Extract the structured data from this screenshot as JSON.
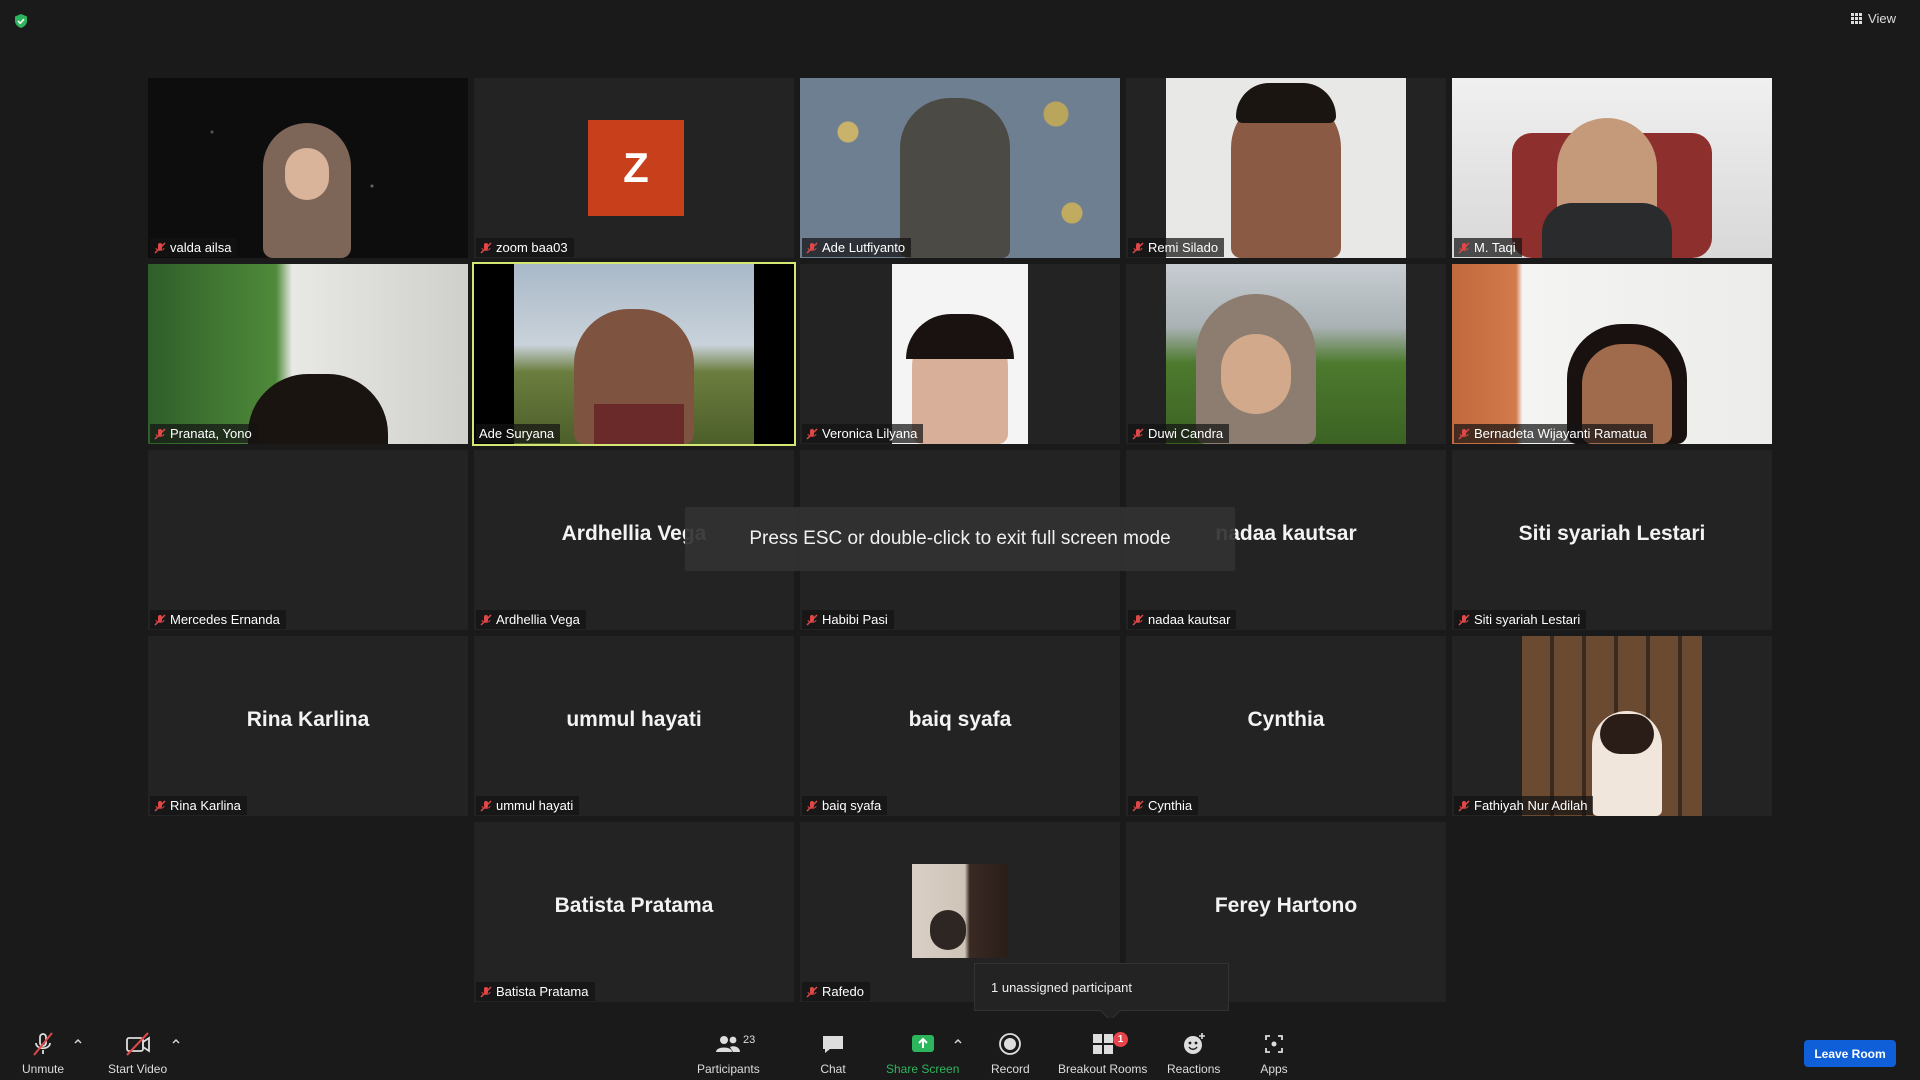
{
  "view_label": "View",
  "toast": "Press ESC or double-click to exit full screen mode",
  "breakout_popup": "1 unassigned participant",
  "participants": [
    {
      "name": "valda ailsa"
    },
    {
      "name": "zoom baa03",
      "initial": "Z"
    },
    {
      "name": "Ade Lutfiyanto"
    },
    {
      "name": "Remi Silado"
    },
    {
      "name": "M. Taqi"
    },
    {
      "name": "Pranata, Yono"
    },
    {
      "name": "Ade Suryana"
    },
    {
      "name": "Veronica Lilyana"
    },
    {
      "name": "Duwi Candra"
    },
    {
      "name": "Bernadeta Wijayanti Ramatua"
    },
    {
      "name": "Mercedes Ernanda"
    },
    {
      "name": "Ardhellia Vega",
      "display": "Ardhellia Vega"
    },
    {
      "name": "Habibi Pasi"
    },
    {
      "name": "nadaa kautsar",
      "display": "nadaa kautsar"
    },
    {
      "name": "Siti syariah Lestari",
      "display": "Siti syariah Lestari"
    },
    {
      "name": "Rina Karlina",
      "display": "Rina Karlina"
    },
    {
      "name": "ummul hayati",
      "display": "ummul hayati"
    },
    {
      "name": "baiq syafa",
      "display": "baiq syafa"
    },
    {
      "name": "Cynthia",
      "display": "Cynthia"
    },
    {
      "name": "Fathiyah Nur Adilah"
    },
    {
      "name": "Batista Pratama",
      "display": "Batista Pratama"
    },
    {
      "name": "Rafedo"
    },
    {
      "name": "Ferey Hartono",
      "display": "Ferey Hartono"
    }
  ],
  "toolbar": {
    "unmute": "Unmute",
    "start_video": "Start Video",
    "participants": "Participants",
    "participants_count": "23",
    "chat": "Chat",
    "share_screen": "Share Screen",
    "record": "Record",
    "breakout_rooms": "Breakout Rooms",
    "breakout_badge": "1",
    "reactions": "Reactions",
    "apps": "Apps",
    "leave": "Leave Room"
  },
  "colors": {
    "speaker_outline": "#d6e673",
    "share_green": "#2db55d",
    "leave_blue": "#0e5fd8",
    "avatar_orange": "#c8401b"
  }
}
